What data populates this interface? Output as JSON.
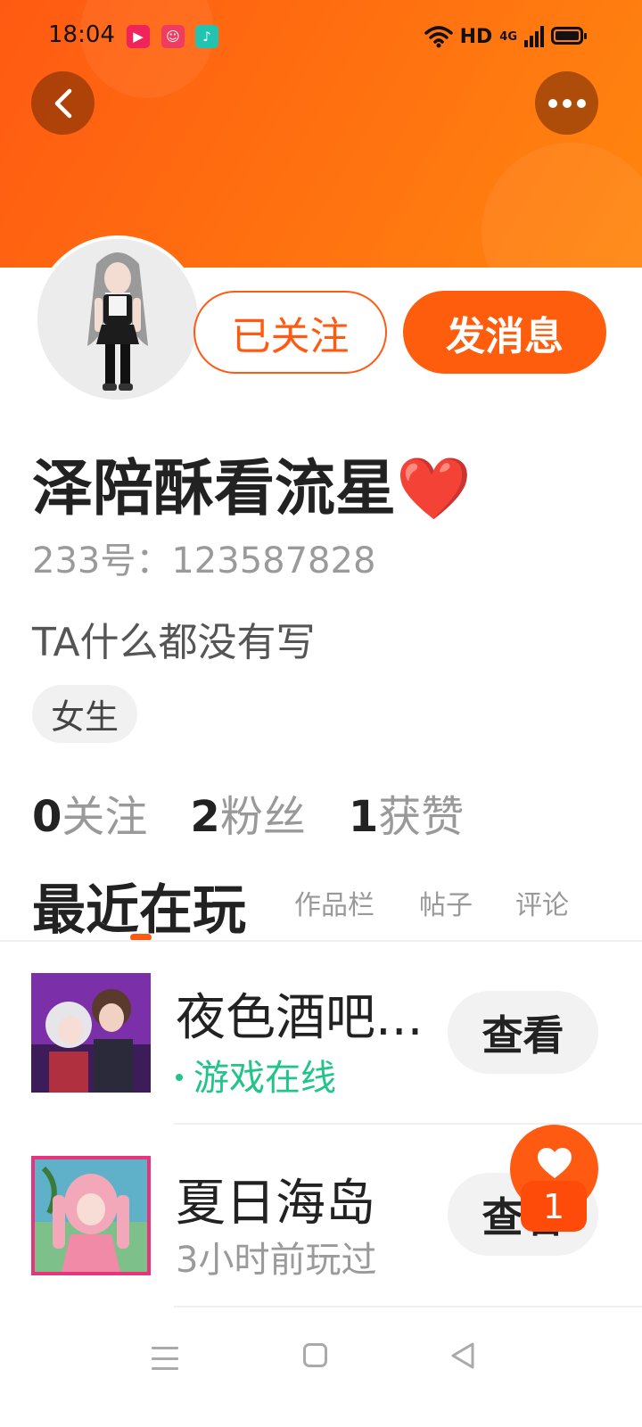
{
  "status_bar": {
    "time": "18:04",
    "network_label": "HD",
    "cell_label": "4G"
  },
  "profile": {
    "follow_label": "已关注",
    "message_label": "发消息",
    "name": "泽陪酥看流星",
    "name_emoji": "❤️",
    "id_text": "233号：123587828",
    "bio": "TA什么都没有写",
    "gender_tag": "女生",
    "stats": [
      {
        "count": "0",
        "label": "关注"
      },
      {
        "count": "2",
        "label": "粉丝"
      },
      {
        "count": "1",
        "label": "获赞"
      }
    ]
  },
  "tabs": {
    "active": "最近在玩",
    "items": [
      "作品栏",
      "帖子",
      "评论"
    ]
  },
  "games": [
    {
      "title": "夜色酒吧...",
      "status": "游戏在线",
      "button": "查看",
      "online": true
    },
    {
      "title": "夏日海岛",
      "status": "3小时前玩过",
      "button": "查看",
      "online": false
    }
  ],
  "floating": {
    "heart_count": "1"
  },
  "colors": {
    "accent": "#ff5a12",
    "online": "#22c48a",
    "muted": "#9a9a9a"
  },
  "icons": [
    "back-icon",
    "more-icon",
    "wifi-icon",
    "signal-icon",
    "battery-icon",
    "heart-icon",
    "nav-menu-icon",
    "nav-home-icon",
    "nav-back-icon"
  ]
}
